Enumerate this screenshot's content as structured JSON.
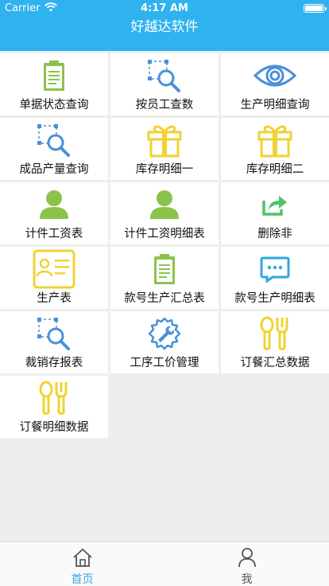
{
  "status_bar": {
    "carrier": "Carrier",
    "time": "4:17 AM"
  },
  "nav": {
    "title": "好越达软件"
  },
  "colors": {
    "header": "#2fb2ef",
    "accent": "#2fa8e0",
    "yellow": "#f1d230",
    "green": "#8bc34a"
  },
  "tiles": [
    {
      "label": "单据状态查询",
      "icon": "clipboard-icon"
    },
    {
      "label": "按员工查数",
      "icon": "search-select-icon"
    },
    {
      "label": "生产明细查询",
      "icon": "eye-icon"
    },
    {
      "label": "成品产量查询",
      "icon": "search-select-icon"
    },
    {
      "label": "库存明细一",
      "icon": "gift-box-icon"
    },
    {
      "label": "库存明细二",
      "icon": "gift-box-icon"
    },
    {
      "label": "计件工资表",
      "icon": "person-icon"
    },
    {
      "label": "计件工资明细表",
      "icon": "person-icon"
    },
    {
      "label": "删除非",
      "icon": "share-icon"
    },
    {
      "label": "生产表",
      "icon": "id-card-icon"
    },
    {
      "label": "款号生产汇总表",
      "icon": "clipboard-icon"
    },
    {
      "label": "款号生产明细表",
      "icon": "chat-bubble-icon"
    },
    {
      "label": "裁销存报表",
      "icon": "search-select-icon"
    },
    {
      "label": "工序工价管理",
      "icon": "wrench-gear-icon"
    },
    {
      "label": "订餐汇总数据",
      "icon": "fork-spoon-icon"
    },
    {
      "label": "订餐明细数据",
      "icon": "fork-spoon-icon"
    }
  ],
  "tabbar": [
    {
      "label": "首页",
      "icon": "home-icon",
      "active": true
    },
    {
      "label": "我",
      "icon": "user-icon",
      "active": false
    }
  ]
}
